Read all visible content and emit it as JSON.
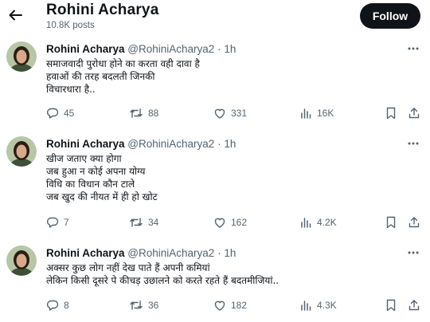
{
  "header": {
    "name": "Rohini Acharya",
    "posts": "10.8K posts",
    "follow_label": "Follow"
  },
  "posts": [
    {
      "name": "Rohini Acharya",
      "handle": "@RohiniAcharya2",
      "dot": "·",
      "time": "1h",
      "lines": [
        "समाजवादी पुरोधा होने का करता वही दावा है",
        "हवाओं की तरह बदलती जिनकी",
        "विचारधारा है.."
      ],
      "replies": "45",
      "reposts": "88",
      "likes": "331",
      "views": "16K"
    },
    {
      "name": "Rohini Acharya",
      "handle": "@RohiniAcharya2",
      "dot": "·",
      "time": "1h",
      "lines": [
        "खीज जताए क्या होगा",
        "जब हुआ न कोई अपना योग्य",
        "विधि का विधान कौन टाले",
        "जब खुद की नीयत में ही हो खोट"
      ],
      "replies": "7",
      "reposts": "34",
      "likes": "162",
      "views": "4.2K"
    },
    {
      "name": "Rohini Acharya",
      "handle": "@RohiniAcharya2",
      "dot": "·",
      "time": "1h",
      "lines": [
        "अक्सर कुछ लोग नहीं देख पाते हैं अपनी कमियां",
        "लेकिन किसी दूसरे पे कीचड़ उछालने को करते रहते हैं बदतमीजियां.."
      ],
      "replies": "8",
      "reposts": "36",
      "likes": "182",
      "views": "4.3K"
    }
  ],
  "icons": {
    "back": "back-arrow-icon",
    "more": "more-icon",
    "reply": "reply-icon",
    "repost": "repost-icon",
    "like": "like-icon",
    "views": "views-icon",
    "bookmark": "bookmark-icon",
    "share": "share-icon"
  },
  "colors": {
    "text": "#0f1419",
    "secondary": "#536471",
    "follow_bg": "#0f1419"
  }
}
